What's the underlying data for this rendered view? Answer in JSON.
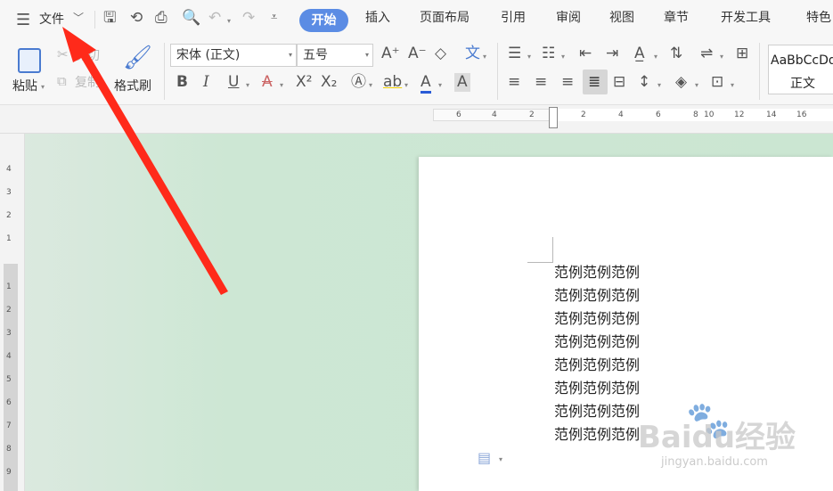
{
  "menu": {
    "file_label": "文件"
  },
  "tabs": [
    {
      "label": "开始",
      "active": true
    },
    {
      "label": "插入"
    },
    {
      "label": "页面布局"
    },
    {
      "label": "引用"
    },
    {
      "label": "审阅"
    },
    {
      "label": "视图"
    },
    {
      "label": "章节"
    },
    {
      "label": "开发工具"
    },
    {
      "label": "特色"
    }
  ],
  "clipboard": {
    "paste_label": "粘贴",
    "cut_label": "剪切",
    "copy_label": "复制",
    "format_painter_label": "格式刷"
  },
  "font": {
    "family": "宋体 (正文)",
    "size": "五号"
  },
  "styles": {
    "preview": "AaBbCcDd",
    "name": "正文"
  },
  "ruler": {
    "horizontal_ticks": [
      "6",
      "4",
      "2",
      "2",
      "4",
      "6",
      "8",
      "10",
      "12",
      "14",
      "16"
    ],
    "vertical_ticks": [
      "4",
      "3",
      "2",
      "1",
      "1",
      "2",
      "3",
      "4",
      "5",
      "6",
      "7",
      "8",
      "9"
    ]
  },
  "document": {
    "lines": [
      "范例范例范例",
      "范例范例范例",
      "范例范例范例",
      "范例范例范例",
      "范例范例范例",
      "范例范例范例",
      "范例范例范例",
      "范例范例范例"
    ]
  },
  "watermark": {
    "text": "Baidu经验",
    "url": "jingyan.baidu.com"
  },
  "colors": {
    "accent": "#5b8ce4",
    "arrow": "#ff2a1a",
    "workspace": "#cbe6d2"
  }
}
